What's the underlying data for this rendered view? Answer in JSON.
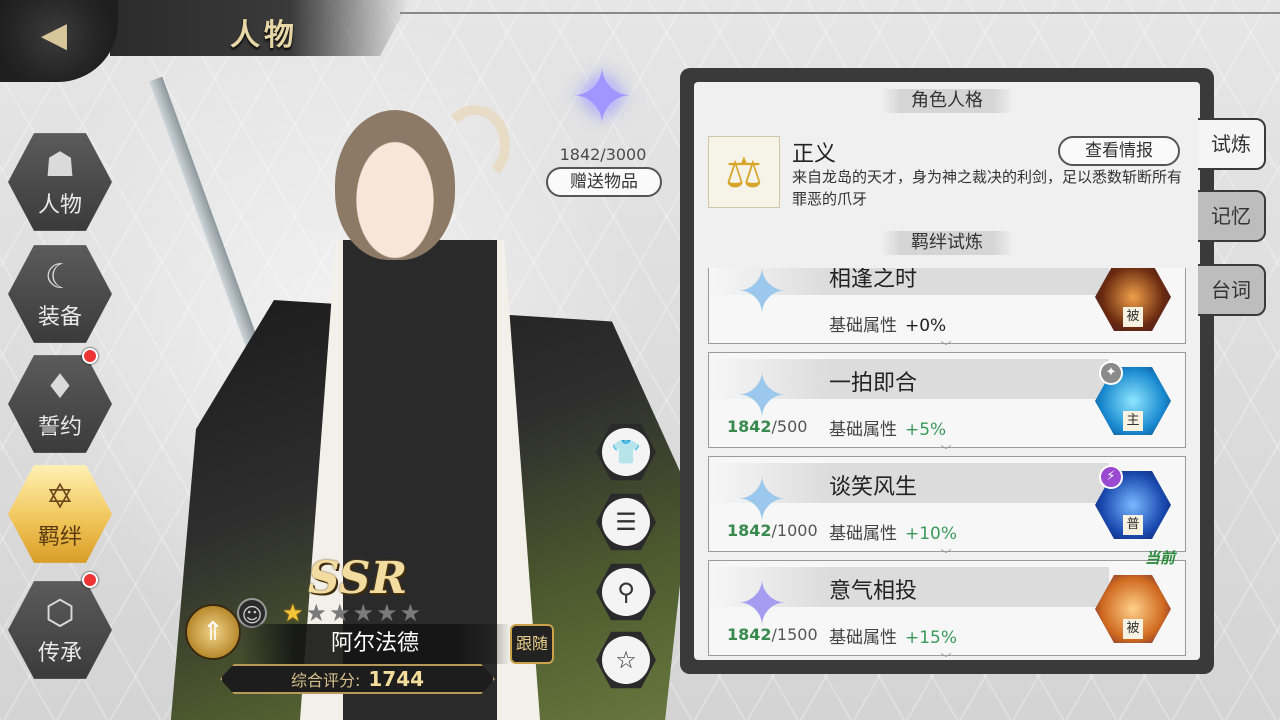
{
  "header": {
    "title": "人物"
  },
  "nav": [
    {
      "label": "人物",
      "icon": "character-icon",
      "active": false,
      "badge": false
    },
    {
      "label": "装备",
      "icon": "equipment-icon",
      "active": false,
      "badge": false
    },
    {
      "label": "誓约",
      "icon": "oath-icon",
      "active": false,
      "badge": true
    },
    {
      "label": "羁绊",
      "icon": "bond-icon",
      "active": true,
      "badge": false
    },
    {
      "label": "传承",
      "icon": "legacy-icon",
      "active": false,
      "badge": true
    }
  ],
  "gift": {
    "count": "1842/3000",
    "button": "赠送物品"
  },
  "character": {
    "rarity": "SSR",
    "name": "阿尔法德",
    "stars_filled": 1,
    "stars_total": 6,
    "follow_label": "跟随",
    "score_label": "综合评分:",
    "score_value": "1744"
  },
  "panel": {
    "persona_header": "角色人格",
    "persona_name": "正义",
    "persona_desc": "来自龙岛的天才，身为神之裁决的利剑，足以悉数斩断所有罪恶的爪牙",
    "info_button": "查看情报",
    "bond_header": "羁绊试炼",
    "bonds": [
      {
        "title": "相逢之时",
        "progress": "",
        "total": "",
        "attr_label": "基础属性",
        "bonus": "+0%",
        "tag": "被",
        "badge": "",
        "current": false,
        "star": "blue"
      },
      {
        "title": "一拍即合",
        "progress": "1842",
        "total": "/500",
        "attr_label": "基础属性",
        "bonus": "+5%",
        "tag": "主",
        "badge": "✦",
        "current": false,
        "star": "blue"
      },
      {
        "title": "谈笑风生",
        "progress": "1842",
        "total": "/1000",
        "attr_label": "基础属性",
        "bonus": "+10%",
        "tag": "普",
        "badge": "⚡",
        "current": false,
        "star": "blue"
      },
      {
        "title": "意气相投",
        "progress": "1842",
        "total": "/1500",
        "attr_label": "基础属性",
        "bonus": "+15%",
        "tag": "被",
        "badge": "",
        "current": true,
        "star": "purple"
      }
    ],
    "current_label": "当前"
  },
  "side_tabs": [
    {
      "label": "试炼",
      "active": true
    },
    {
      "label": "记忆",
      "active": false
    },
    {
      "label": "台词",
      "active": false
    }
  ],
  "colors": {
    "accent_gold": "#f1c65a",
    "bonus_green": "#3a9a5a",
    "panel_dark": "#3a3a3a"
  }
}
